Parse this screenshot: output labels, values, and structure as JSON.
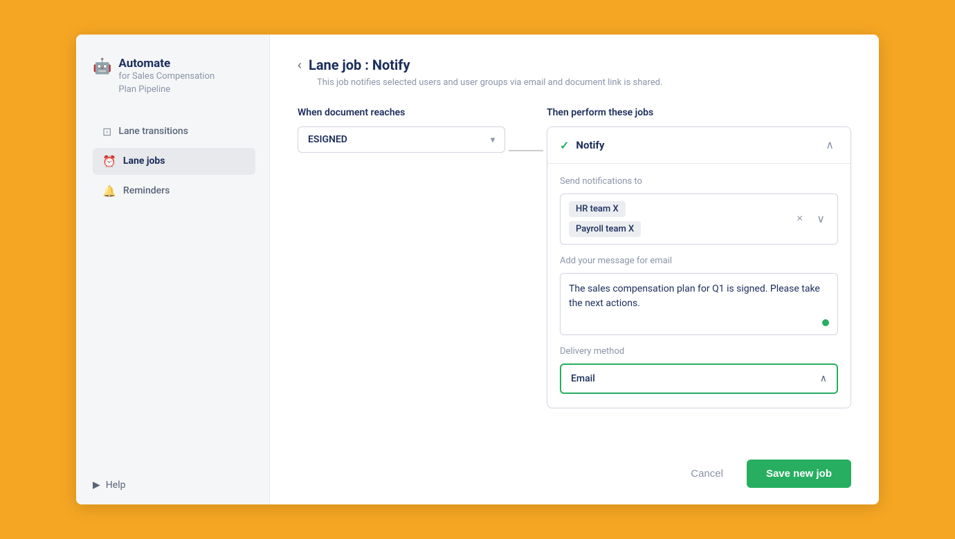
{
  "sidebar": {
    "brand": {
      "icon": "🤖",
      "title": "Automate",
      "subtitle": "for Sales Compensation\nPlan Pipeline"
    },
    "nav_items": [
      {
        "id": "lane-transitions",
        "label": "Lane transitions",
        "icon": "□",
        "active": false
      },
      {
        "id": "lane-jobs",
        "label": "Lane jobs",
        "icon": "⏰",
        "active": true
      },
      {
        "id": "reminders",
        "label": "Reminders",
        "icon": "🔔",
        "active": false
      }
    ],
    "footer": {
      "help_label": "Help",
      "help_icon": "▶"
    }
  },
  "page": {
    "back_icon": "‹",
    "title": "Lane job : Notify",
    "subtitle": "This job notifies selected users and user groups via email and document link is shared."
  },
  "when_section": {
    "label": "When document reaches",
    "dropdown_value": "ESIGNED",
    "dropdown_arrow": "▾"
  },
  "then_section": {
    "label": "Then perform these jobs",
    "job_card": {
      "check_icon": "✓",
      "title": "Notify",
      "collapse_icon": "∧",
      "send_notifications_label": "Send notifications to",
      "tags": [
        {
          "label": "HR team X"
        },
        {
          "label": "Payroll team X"
        }
      ],
      "tag_remove_icon": "×",
      "tag_dropdown_icon": "∨",
      "message_label": "Add your message for email",
      "message_text": "The sales compensation plan for Q1 is signed. Please take the next actions.",
      "delivery_label": "Delivery method",
      "delivery_value": "Email",
      "delivery_arrow": "∧"
    }
  },
  "footer": {
    "cancel_label": "Cancel",
    "save_label": "Save new job"
  }
}
